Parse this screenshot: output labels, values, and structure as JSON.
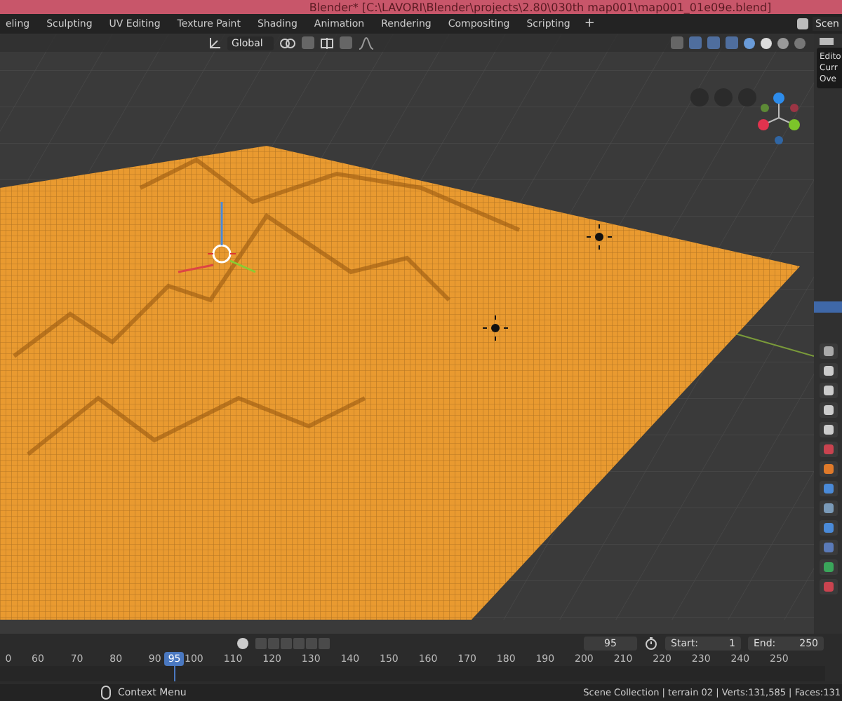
{
  "window": {
    "title": "Blender* [C:\\LAVORI\\Blender\\projects\\2.80\\030th map001\\map001_01e09e.blend]"
  },
  "workspace_tabs": [
    {
      "label": "eling",
      "selected": false
    },
    {
      "label": "Sculpting",
      "selected": false
    },
    {
      "label": "UV Editing",
      "selected": false
    },
    {
      "label": "Texture Paint",
      "selected": false
    },
    {
      "label": "Shading",
      "selected": false
    },
    {
      "label": "Animation",
      "selected": false
    },
    {
      "label": "Rendering",
      "selected": false
    },
    {
      "label": "Compositing",
      "selected": false
    },
    {
      "label": "Scripting",
      "selected": false
    }
  ],
  "add_tab": "+",
  "scene_field": "Scen",
  "header": {
    "orientation": "Global"
  },
  "outliner": {
    "items": [
      "Edito",
      "Curr",
      "Ove"
    ]
  },
  "timeline": {
    "current_frame": "95",
    "start_label": "Start:",
    "start": "1",
    "end_label": "End:",
    "end": "250",
    "ticks": [
      {
        "label": "0",
        "selected": false
      },
      {
        "label": "60",
        "selected": false
      },
      {
        "label": "70",
        "selected": false
      },
      {
        "label": "80",
        "selected": false
      },
      {
        "label": "90",
        "selected": false
      },
      {
        "label": "95",
        "selected": true
      },
      {
        "label": "100",
        "selected": false
      },
      {
        "label": "110",
        "selected": false
      },
      {
        "label": "120",
        "selected": false
      },
      {
        "label": "130",
        "selected": false
      },
      {
        "label": "140",
        "selected": false
      },
      {
        "label": "150",
        "selected": false
      },
      {
        "label": "160",
        "selected": false
      },
      {
        "label": "170",
        "selected": false
      },
      {
        "label": "180",
        "selected": false
      },
      {
        "label": "190",
        "selected": false
      },
      {
        "label": "200",
        "selected": false
      },
      {
        "label": "210",
        "selected": false
      },
      {
        "label": "220",
        "selected": false
      },
      {
        "label": "230",
        "selected": false
      },
      {
        "label": "240",
        "selected": false
      },
      {
        "label": "250",
        "selected": false
      }
    ]
  },
  "status_bar": {
    "hint": "Context Menu",
    "stats": "Scene Collection | terrain 02 | Verts:131,585 | Faces:131"
  }
}
